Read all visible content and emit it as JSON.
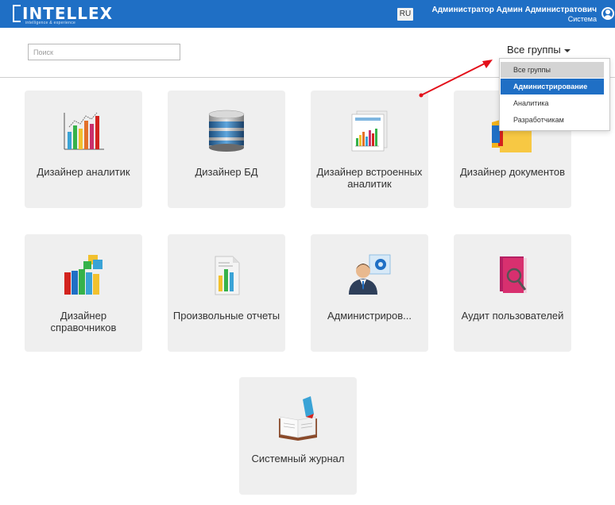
{
  "header": {
    "logo": "INTELLEX",
    "logo_sub": "intelligence & experience",
    "language": "RU",
    "user_name": "Администратор Админ Администратович",
    "user_role": "Система"
  },
  "toolbar": {
    "search_placeholder": "Поиск",
    "groups_label": "Все группы"
  },
  "dropdown": {
    "options": [
      "Все группы",
      "Администрирование",
      "Аналитика",
      "Разработчикам"
    ],
    "selected": "Все группы",
    "highlighted": "Администрирование"
  },
  "tiles": [
    {
      "label": "Дизайнер аналитик",
      "icon": "bar-chart-icon"
    },
    {
      "label": "Дизайнер БД",
      "icon": "database-icon"
    },
    {
      "label": "Дизайнер встроенных аналитик",
      "icon": "report-chart-icon"
    },
    {
      "label": "Дизайнер документов",
      "icon": "folders-icon"
    },
    {
      "label": "Дизайнер справочников",
      "icon": "books-icon"
    },
    {
      "label": "Произвольные отчеты",
      "icon": "document-chart-icon"
    },
    {
      "label": "Администриров...",
      "icon": "admin-user-icon"
    },
    {
      "label": "Аудит пользователей",
      "icon": "audit-book-icon"
    },
    {
      "label": "Системный журнал",
      "icon": "journal-icon"
    }
  ],
  "colors": {
    "header": "#1f6fc5",
    "tile": "#efefef",
    "highlight": "#1f6fc5",
    "arrow": "#e3101a"
  }
}
